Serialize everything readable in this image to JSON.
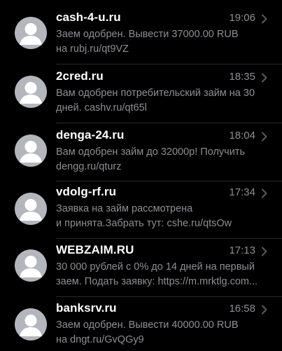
{
  "conversations": [
    {
      "sender": "cash-4-u.ru",
      "time": "19:06",
      "line1": "Заем одобрен. Вывести 37000.00 RUB",
      "line2": "на rubj.ru/qt9VZ"
    },
    {
      "sender": "2cred.ru",
      "time": "18:35",
      "line1": "Вам одобрен потребительский займ на 30",
      "line2": "дней. cashv.ru/qt65l"
    },
    {
      "sender": "denga-24.ru",
      "time": "18:04",
      "line1": "Вам одобрен займ до 32000р! Получить",
      "line2": "dengg.ru/qturz"
    },
    {
      "sender": "vdolg-rf.ru",
      "time": "17:34",
      "line1": "Заявка на займ рассмотрена",
      "line2": "и принята.Забрать тут: cshe.ru/qtsOw"
    },
    {
      "sender": "WEBZAIM.RU",
      "time": "17:13",
      "line1": "30 000 рублей с 0% до 14 дней на первый",
      "line2": "заем. Подать заявку: https://m.mrktlg.com..."
    },
    {
      "sender": "banksrv.ru",
      "time": "16:58",
      "line1": "Заем одобрен. Вывести 40000.00 RUB",
      "line2": "на dngt.ru/GvQGy9"
    }
  ],
  "icons": {
    "avatar": "person-placeholder-icon",
    "chevron": "chevron-right-icon"
  },
  "colors": {
    "background": "#000000",
    "sender": "#ffffff",
    "secondary": "#8e8e93",
    "avatar": "#b4b6bd"
  }
}
